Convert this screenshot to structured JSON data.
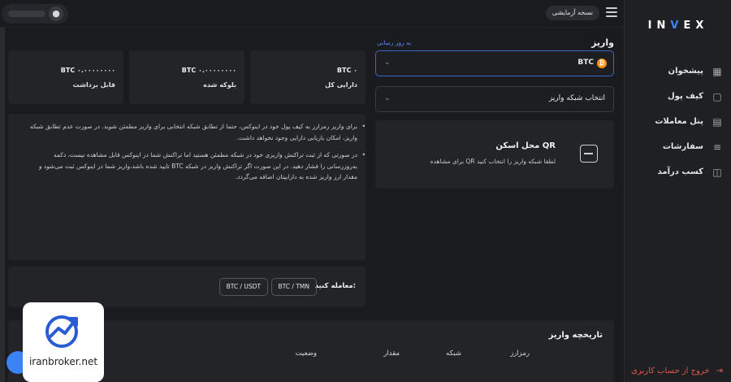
{
  "brand": {
    "logo": "INVEX"
  },
  "header": {
    "demo_badge": "نسخه آزمایشی"
  },
  "sidebar": {
    "items": [
      {
        "label": "پیشخوان",
        "icon": "dashboard-icon"
      },
      {
        "label": "کیف پول",
        "icon": "wallet-icon"
      },
      {
        "label": "پنل معاملات",
        "icon": "trading-panel-icon"
      },
      {
        "label": "سفارشات",
        "icon": "orders-icon"
      },
      {
        "label": "کسب درآمد",
        "icon": "earn-icon"
      }
    ],
    "logout": "خروج از حساب کاربری"
  },
  "deposit": {
    "title": "واریز",
    "update_link": "به روز رسانی",
    "coin": "BTC",
    "network_placeholder": "انتخاب شبکه واریز",
    "qr_title": "محل اسکن QR",
    "qr_hint": "برای مشاهده QR لطفا شبکه واریز را انتخاب کنید"
  },
  "balances": [
    {
      "amount": "BTC ۰",
      "label": "دارایی کل"
    },
    {
      "amount": "BTC ۰.۰۰۰۰۰۰۰۰",
      "label": "بلوکه شده"
    },
    {
      "amount": "BTC ۰.۰۰۰۰۰۰۰۰",
      "label": "قابل برداشت"
    }
  ],
  "notes": [
    "برای واریز رمزارز به کیف پول خود در اینوکس، حتما از تطابق شبکه انتخابی برای واریز مطمئن شوید. در صورت عدم تطابق شبکه واریز، امکان بازیابی دارایی وجود نخواهد داشت.",
    "در صورتی که از ثبت تراکنش واریزی خود در شبکه مطمئن هستید اما تراکنش شما در اینوکس قابل مشاهده نیست، دکمه به‌روزرسانی را فشار دهید. در این صورت اگر تراکنش واریز در شبکه BTC تایید شده باشد،واریز شما در اینوکس ثبت می‌شود و مقدار ارز واریز شده به داراییتان اضافه می‌گردد."
  ],
  "trade": {
    "label": "معامله کنید:",
    "pairs": [
      "BTC / TMN",
      "BTC / USDT"
    ]
  },
  "history": {
    "title": "تاریخچه واریز",
    "columns": [
      "رمزارز",
      "شبکه",
      "مقدار",
      "وضعیت"
    ]
  },
  "watermark": {
    "text": "iranbroker.net"
  },
  "colors": {
    "accent": "#3b82f6",
    "btc": "#f7931a",
    "danger": "#e0554e",
    "bg": "#1a1b1f",
    "card": "#232428"
  }
}
